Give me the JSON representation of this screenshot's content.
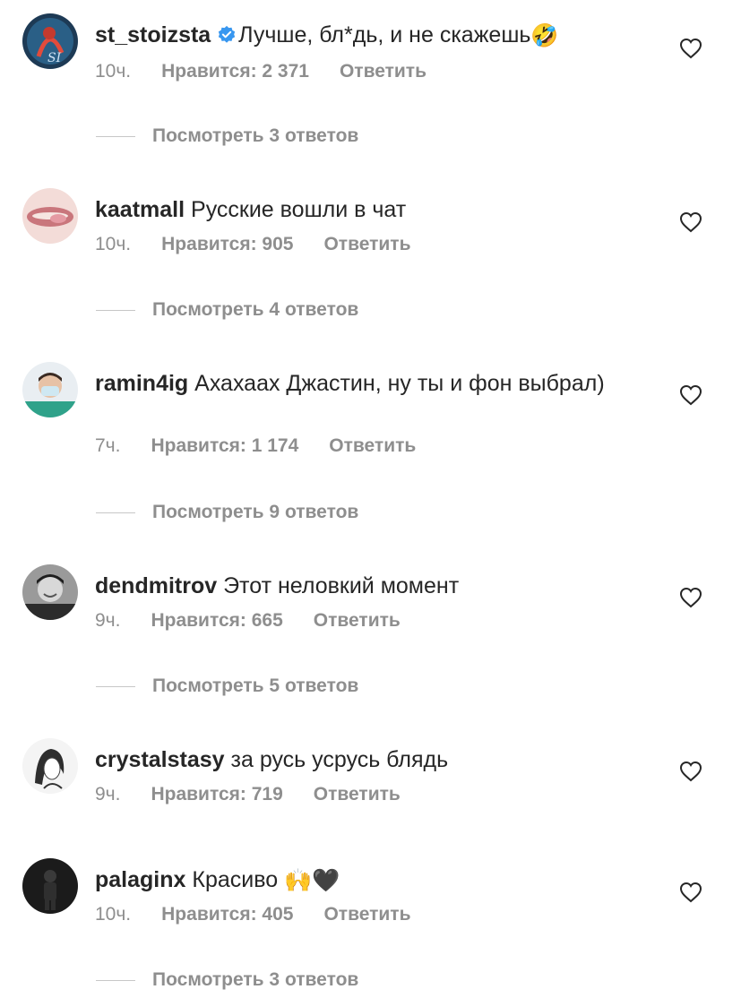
{
  "comments": [
    {
      "username": "st_stoizsta",
      "verified": true,
      "text": "Лучше, бл*дь, и не скажешь",
      "emoji": "🤣",
      "time": "10ч.",
      "likes": "Нравится: 2 371",
      "reply": "Ответить",
      "view_replies": "Посмотреть 3 ответов",
      "avatar_icon": "avatar-illustration"
    },
    {
      "username": "kaatmall",
      "text": "Русские вошли в чат",
      "time": "10ч.",
      "likes": "Нравится: 905",
      "reply": "Ответить",
      "view_replies": "Посмотреть 4 ответов",
      "avatar_icon": "avatar-lips"
    },
    {
      "username": "ramin4ig",
      "text": "Ахахаах Джастин, ну ты и фон выбрал)",
      "time": "7ч.",
      "likes": "Нравится: 1 174",
      "reply": "Ответить",
      "view_replies": "Посмотреть 9 ответов",
      "avatar_icon": "avatar-person-mask"
    },
    {
      "username": "dendmitrov",
      "text": "Этот неловкий момент",
      "time": "9ч.",
      "likes": "Нравится: 665",
      "reply": "Ответить",
      "view_replies": "Посмотреть 5 ответов",
      "avatar_icon": "avatar-person-bw"
    },
    {
      "username": "crystalstasy",
      "text": "за русь усрусь блядь",
      "time": "9ч.",
      "likes": "Нравится: 719",
      "reply": "Ответить",
      "avatar_icon": "avatar-sketch"
    },
    {
      "username": "palaginx",
      "text": "Красиво",
      "emoji": "🙌🖤",
      "time": "10ч.",
      "likes": "Нравится: 405",
      "reply": "Ответить",
      "view_replies": "Посмотреть 3 ответов",
      "avatar_icon": "avatar-dark-figure"
    }
  ],
  "colors": {
    "text": "#262626",
    "secondary": "#8e8e8e",
    "verified": "#3897f0",
    "divider": "#c7c7c7"
  }
}
